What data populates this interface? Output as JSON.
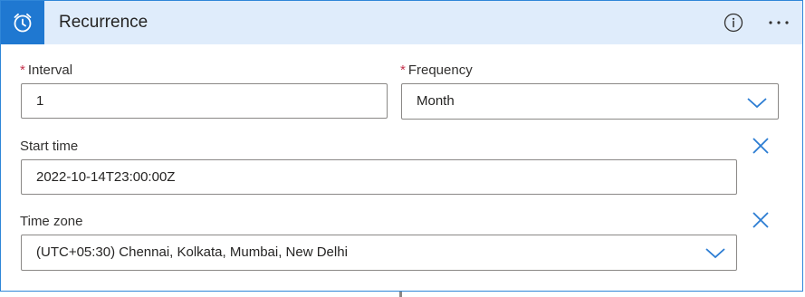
{
  "card": {
    "title": "Recurrence",
    "icon": "alarm-clock-icon",
    "info_icon": "info-icon",
    "more_icon": "more-ellipsis-icon"
  },
  "fields": {
    "interval": {
      "required_mark": "*",
      "label": "Interval",
      "value": "1"
    },
    "frequency": {
      "required_mark": "*",
      "label": "Frequency",
      "value": "Month"
    },
    "start_time": {
      "label": "Start time",
      "value": "2022-10-14T23:00:00Z"
    },
    "time_zone": {
      "label": "Time zone",
      "value": "(UTC+05:30) Chennai, Kolkata, Mumbai, New Delhi"
    }
  },
  "colors": {
    "accent": "#1f78d1",
    "header_bg": "#dfecfb",
    "required": "#c4314b",
    "icon_blue": "#2b7cd3"
  }
}
